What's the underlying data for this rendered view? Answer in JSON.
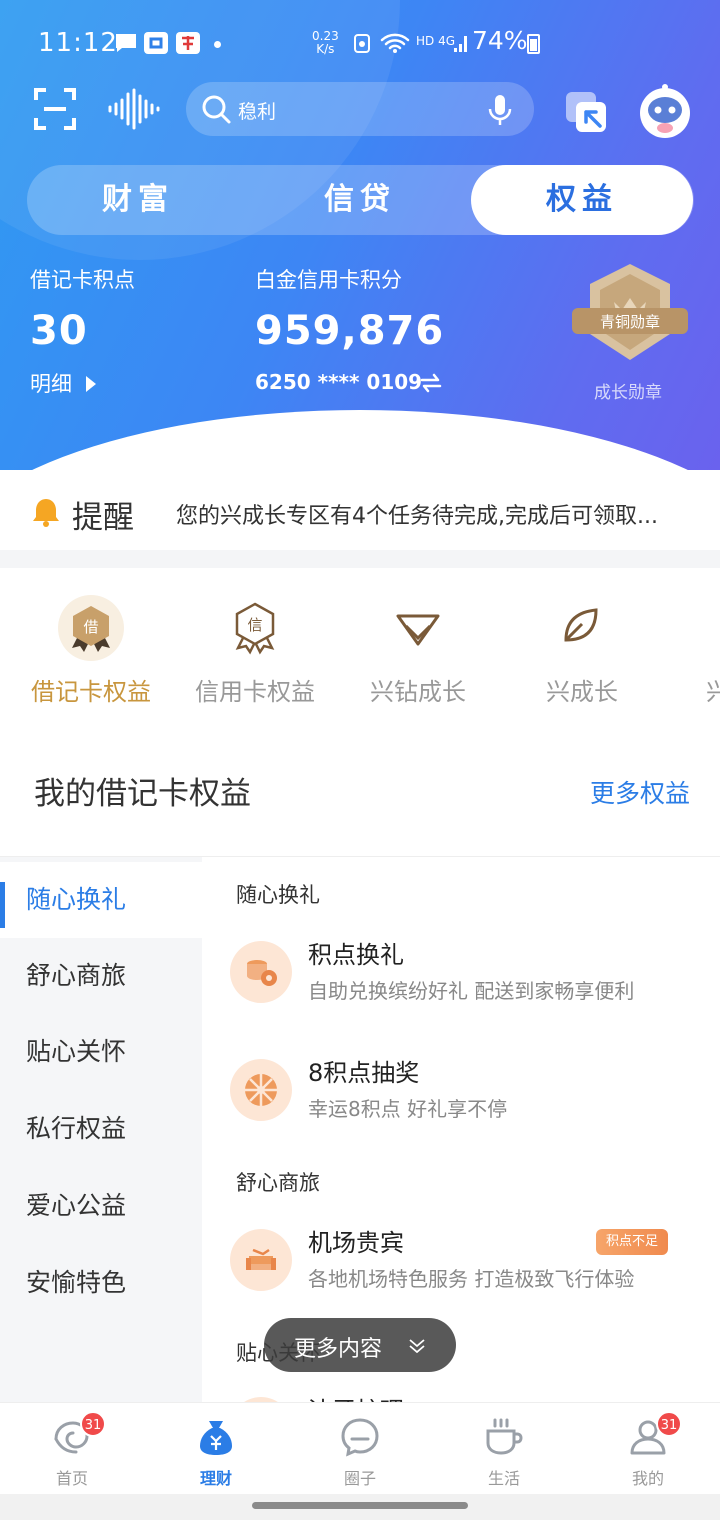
{
  "status_bar": {
    "time": "11:12",
    "net_speed_value": "0.23",
    "net_speed_unit": "K/s",
    "right_indicators": "HD 4G",
    "battery": "74%"
  },
  "search": {
    "placeholder": "稳利"
  },
  "tabs": [
    {
      "label": "财富",
      "active": false
    },
    {
      "label": "信贷",
      "active": false
    },
    {
      "label": "权益",
      "active": true
    }
  ],
  "points": {
    "debit_label": "借记卡积点",
    "debit_value": "30",
    "detail_label": "明细",
    "credit_label": "白金信用卡积分",
    "credit_value": "959,876",
    "card_number": "6250 **** 0109",
    "badge_text": "青铜勋章",
    "badge_caption": "成长勋章"
  },
  "reminder": {
    "title": "提醒",
    "message": "您的兴成长专区有4个任务待完成,完成后可领取..."
  },
  "categories": [
    {
      "label": "借记卡权益",
      "icon": "debit-badge-icon",
      "glyph": "借",
      "active": true
    },
    {
      "label": "信用卡权益",
      "icon": "credit-badge-icon",
      "glyph": "信",
      "active": false
    },
    {
      "label": "兴钻成长",
      "icon": "diamond-icon",
      "active": false
    },
    {
      "label": "兴成长",
      "icon": "leaf-icon",
      "active": false
    },
    {
      "label": "兴",
      "icon": "partial-icon",
      "active": false
    }
  ],
  "section": {
    "title": "我的借记卡权益",
    "more": "更多权益"
  },
  "left_nav": [
    {
      "label": "随心换礼",
      "active": true
    },
    {
      "label": "舒心商旅",
      "active": false
    },
    {
      "label": "贴心关怀",
      "active": false
    },
    {
      "label": "私行权益",
      "active": false
    },
    {
      "label": "爱心公益",
      "active": false
    },
    {
      "label": "安愉特色",
      "active": false
    }
  ],
  "benefits": {
    "group1": "随心换礼",
    "group2": "舒心商旅",
    "group3": "贴心关怀",
    "items": [
      {
        "name": "积点换礼",
        "desc": "自助兑换缤纷好礼 配送到家畅享便利",
        "icon": "coins-icon"
      },
      {
        "name": "8积点抽奖",
        "desc": "幸运8积点 好礼享不停",
        "icon": "wheel-icon"
      },
      {
        "name": "机场贵宾",
        "desc": "各地机场特色服务 打造极致飞行体验",
        "icon": "sofa-icon",
        "tag": "积点不足"
      },
      {
        "name": "洁牙护理",
        "desc": "",
        "icon": "tooth-icon"
      }
    ]
  },
  "more_pill": "更多内容",
  "tabbar": [
    {
      "label": "首页",
      "badge": "31",
      "active": false
    },
    {
      "label": "理财",
      "badge": "",
      "active": true
    },
    {
      "label": "圈子",
      "badge": "",
      "active": false
    },
    {
      "label": "生活",
      "badge": "",
      "active": false
    },
    {
      "label": "我的",
      "badge": "31",
      "active": false
    }
  ],
  "colors": {
    "accent_blue": "#2b7de6",
    "gold": "#c8963e",
    "badge_red": "#f04a4a",
    "tag_orange": "#f08a4e"
  }
}
